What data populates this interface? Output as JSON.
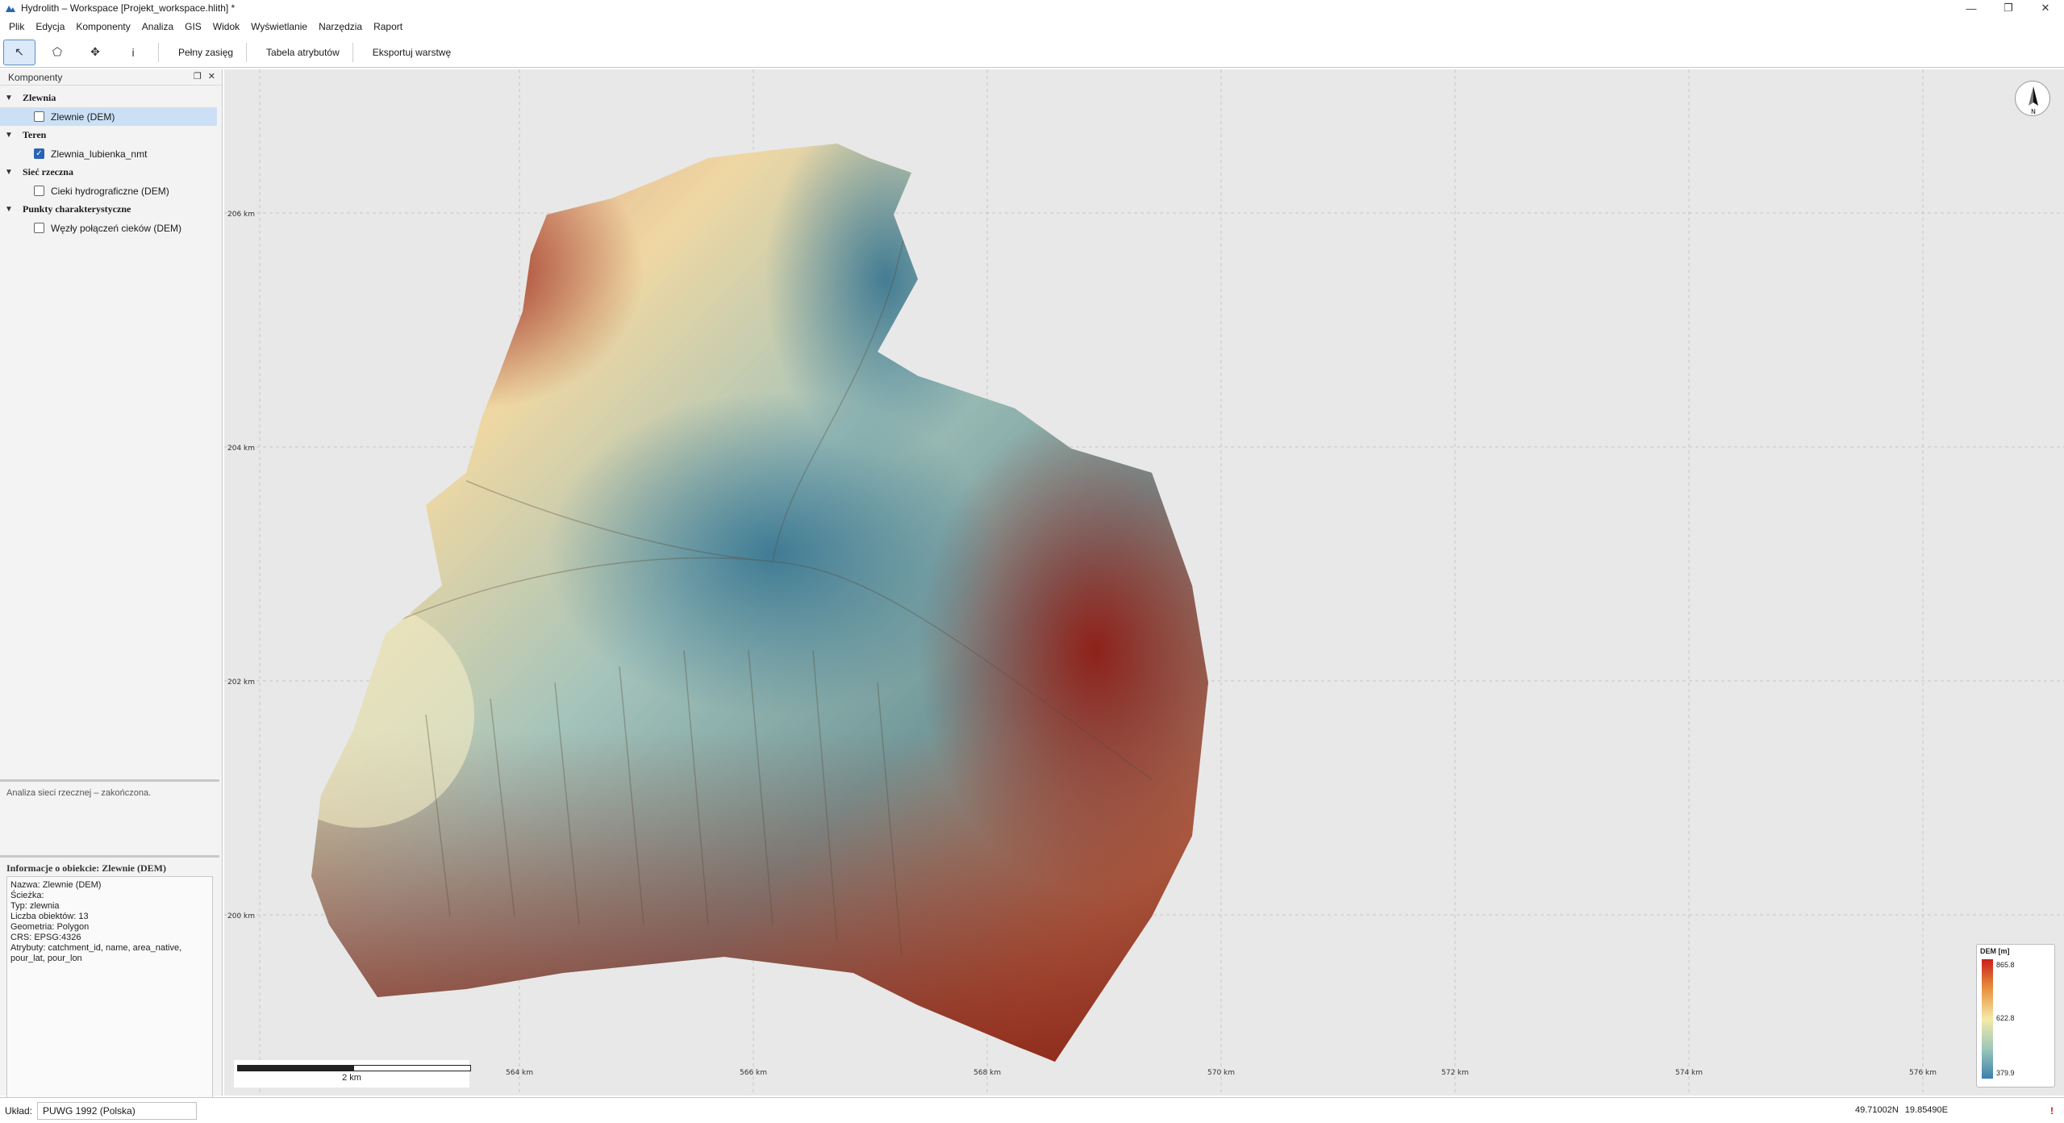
{
  "window": {
    "title": "Hydrolith – Workspace  [Projekt_workspace.hlith] *",
    "controls": {
      "minimize": "—",
      "maximize": "❐",
      "close": "✕"
    }
  },
  "menu": [
    "Plik",
    "Edycja",
    "Komponenty",
    "Analiza",
    "GIS",
    "Widok",
    "Wyświetlanie",
    "Narzędzia",
    "Raport"
  ],
  "toolbar": {
    "tools": [
      {
        "icon": "pointer-icon",
        "glyph": "↖",
        "active": true
      },
      {
        "icon": "polygon-icon",
        "glyph": "⬠",
        "active": false
      },
      {
        "icon": "pan-icon",
        "glyph": "✥",
        "active": false
      },
      {
        "icon": "info-icon",
        "glyph": "i",
        "active": false
      }
    ],
    "full_extent": "Pełny zasięg",
    "attribute_table": "Tabela atrybutów",
    "export_layer": "Eksportuj warstwę"
  },
  "components_panel": {
    "title": "Komponenty",
    "groups": [
      {
        "name": "Zlewnia",
        "items": [
          {
            "label": "Zlewnie (DEM)",
            "checked": false,
            "selected": true
          }
        ]
      },
      {
        "name": "Teren",
        "items": [
          {
            "label": "Zlewnia_lubienka_nmt",
            "checked": true,
            "selected": false
          }
        ]
      },
      {
        "name": "Sieć rzeczna",
        "items": [
          {
            "label": "Cieki hydrograficzne (DEM)",
            "checked": false,
            "selected": false
          }
        ]
      },
      {
        "name": "Punkty charakterystyczne",
        "items": [
          {
            "label": "Węzły połączeń cieków (DEM)",
            "checked": false,
            "selected": false
          }
        ]
      }
    ]
  },
  "status_message": "Analiza sieci rzecznej – zakończona.",
  "object_info": {
    "title": "Informacje o obiekcie: Zlewnie (DEM)",
    "lines": [
      "Nazwa: Zlewnie (DEM)",
      "Ścieżka:",
      "Typ: zlewnia",
      "Liczba obiektów: 13",
      "Geometria: Polygon",
      "CRS: EPSG:4326",
      "Atrybuty: catchment_id, name, area_native,",
      "pour_lat, pour_lon"
    ]
  },
  "map": {
    "x_ticks": [
      "564 km",
      "566 km",
      "568 km",
      "570 km",
      "572 km",
      "574 km",
      "576 km"
    ],
    "y_ticks": [
      "206 km",
      "204 km",
      "202 km",
      "200 km"
    ],
    "scalebar_label": "2 km",
    "north_label": "N",
    "legend": {
      "title": "DEM [m]",
      "max": "865.8",
      "mid": "622.8",
      "min": "379.9"
    }
  },
  "bottom": {
    "crs_label": "Układ:",
    "crs_value": "PUWG 1992 (Polska)",
    "lat": "49.71002N",
    "lon": "19.85490E",
    "help": "!"
  }
}
